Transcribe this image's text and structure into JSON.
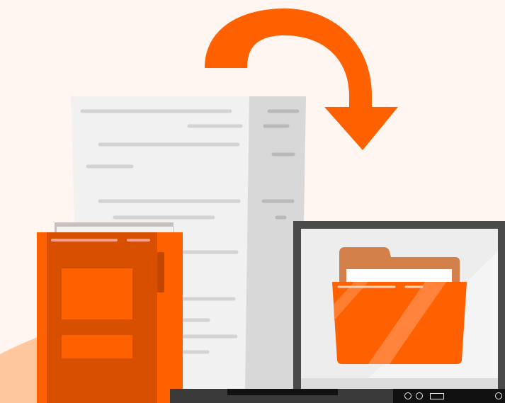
{
  "scene": {
    "illustration": "document-transfer-to-laptop-folder",
    "colors": {
      "background": "#fff5f1",
      "accent_orange": "#ff6100",
      "dark_orange": "#d94f00",
      "paper": "#f1f1f1",
      "laptop_frame": "#4a4a4a",
      "taskbar": "#111111"
    },
    "icons": [
      "curved-arrow-icon",
      "document-icon",
      "binder-icon",
      "laptop-icon",
      "folder-icon"
    ]
  }
}
